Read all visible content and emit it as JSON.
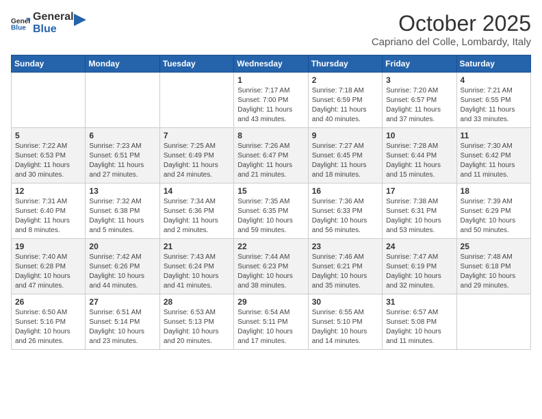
{
  "header": {
    "logo_general": "General",
    "logo_blue": "Blue",
    "month": "October 2025",
    "location": "Capriano del Colle, Lombardy, Italy"
  },
  "weekdays": [
    "Sunday",
    "Monday",
    "Tuesday",
    "Wednesday",
    "Thursday",
    "Friday",
    "Saturday"
  ],
  "weeks": [
    [
      {
        "day": "",
        "info": ""
      },
      {
        "day": "",
        "info": ""
      },
      {
        "day": "",
        "info": ""
      },
      {
        "day": "1",
        "info": "Sunrise: 7:17 AM\nSunset: 7:00 PM\nDaylight: 11 hours\nand 43 minutes."
      },
      {
        "day": "2",
        "info": "Sunrise: 7:18 AM\nSunset: 6:59 PM\nDaylight: 11 hours\nand 40 minutes."
      },
      {
        "day": "3",
        "info": "Sunrise: 7:20 AM\nSunset: 6:57 PM\nDaylight: 11 hours\nand 37 minutes."
      },
      {
        "day": "4",
        "info": "Sunrise: 7:21 AM\nSunset: 6:55 PM\nDaylight: 11 hours\nand 33 minutes."
      }
    ],
    [
      {
        "day": "5",
        "info": "Sunrise: 7:22 AM\nSunset: 6:53 PM\nDaylight: 11 hours\nand 30 minutes."
      },
      {
        "day": "6",
        "info": "Sunrise: 7:23 AM\nSunset: 6:51 PM\nDaylight: 11 hours\nand 27 minutes."
      },
      {
        "day": "7",
        "info": "Sunrise: 7:25 AM\nSunset: 6:49 PM\nDaylight: 11 hours\nand 24 minutes."
      },
      {
        "day": "8",
        "info": "Sunrise: 7:26 AM\nSunset: 6:47 PM\nDaylight: 11 hours\nand 21 minutes."
      },
      {
        "day": "9",
        "info": "Sunrise: 7:27 AM\nSunset: 6:45 PM\nDaylight: 11 hours\nand 18 minutes."
      },
      {
        "day": "10",
        "info": "Sunrise: 7:28 AM\nSunset: 6:44 PM\nDaylight: 11 hours\nand 15 minutes."
      },
      {
        "day": "11",
        "info": "Sunrise: 7:30 AM\nSunset: 6:42 PM\nDaylight: 11 hours\nand 11 minutes."
      }
    ],
    [
      {
        "day": "12",
        "info": "Sunrise: 7:31 AM\nSunset: 6:40 PM\nDaylight: 11 hours\nand 8 minutes."
      },
      {
        "day": "13",
        "info": "Sunrise: 7:32 AM\nSunset: 6:38 PM\nDaylight: 11 hours\nand 5 minutes."
      },
      {
        "day": "14",
        "info": "Sunrise: 7:34 AM\nSunset: 6:36 PM\nDaylight: 11 hours\nand 2 minutes."
      },
      {
        "day": "15",
        "info": "Sunrise: 7:35 AM\nSunset: 6:35 PM\nDaylight: 10 hours\nand 59 minutes."
      },
      {
        "day": "16",
        "info": "Sunrise: 7:36 AM\nSunset: 6:33 PM\nDaylight: 10 hours\nand 56 minutes."
      },
      {
        "day": "17",
        "info": "Sunrise: 7:38 AM\nSunset: 6:31 PM\nDaylight: 10 hours\nand 53 minutes."
      },
      {
        "day": "18",
        "info": "Sunrise: 7:39 AM\nSunset: 6:29 PM\nDaylight: 10 hours\nand 50 minutes."
      }
    ],
    [
      {
        "day": "19",
        "info": "Sunrise: 7:40 AM\nSunset: 6:28 PM\nDaylight: 10 hours\nand 47 minutes."
      },
      {
        "day": "20",
        "info": "Sunrise: 7:42 AM\nSunset: 6:26 PM\nDaylight: 10 hours\nand 44 minutes."
      },
      {
        "day": "21",
        "info": "Sunrise: 7:43 AM\nSunset: 6:24 PM\nDaylight: 10 hours\nand 41 minutes."
      },
      {
        "day": "22",
        "info": "Sunrise: 7:44 AM\nSunset: 6:23 PM\nDaylight: 10 hours\nand 38 minutes."
      },
      {
        "day": "23",
        "info": "Sunrise: 7:46 AM\nSunset: 6:21 PM\nDaylight: 10 hours\nand 35 minutes."
      },
      {
        "day": "24",
        "info": "Sunrise: 7:47 AM\nSunset: 6:19 PM\nDaylight: 10 hours\nand 32 minutes."
      },
      {
        "day": "25",
        "info": "Sunrise: 7:48 AM\nSunset: 6:18 PM\nDaylight: 10 hours\nand 29 minutes."
      }
    ],
    [
      {
        "day": "26",
        "info": "Sunrise: 6:50 AM\nSunset: 5:16 PM\nDaylight: 10 hours\nand 26 minutes."
      },
      {
        "day": "27",
        "info": "Sunrise: 6:51 AM\nSunset: 5:14 PM\nDaylight: 10 hours\nand 23 minutes."
      },
      {
        "day": "28",
        "info": "Sunrise: 6:53 AM\nSunset: 5:13 PM\nDaylight: 10 hours\nand 20 minutes."
      },
      {
        "day": "29",
        "info": "Sunrise: 6:54 AM\nSunset: 5:11 PM\nDaylight: 10 hours\nand 17 minutes."
      },
      {
        "day": "30",
        "info": "Sunrise: 6:55 AM\nSunset: 5:10 PM\nDaylight: 10 hours\nand 14 minutes."
      },
      {
        "day": "31",
        "info": "Sunrise: 6:57 AM\nSunset: 5:08 PM\nDaylight: 10 hours\nand 11 minutes."
      },
      {
        "day": "",
        "info": ""
      }
    ]
  ]
}
